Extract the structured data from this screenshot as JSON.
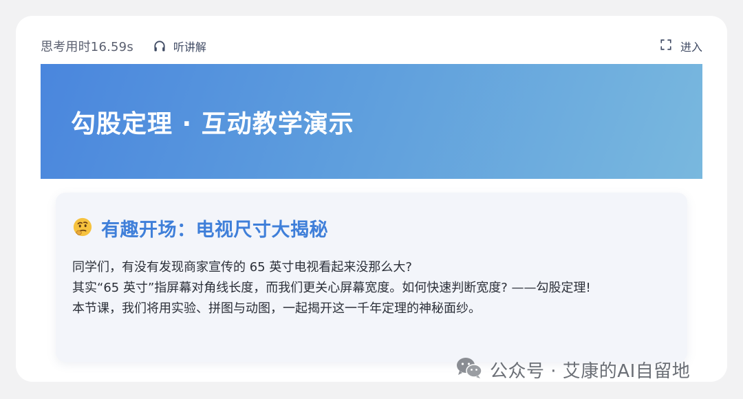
{
  "header": {
    "think_time": "思考用时16.59s",
    "listen_label": "听讲解",
    "enter_label": "进入"
  },
  "banner": {
    "title": "勾股定理 · 互动教学演示"
  },
  "section": {
    "emoji": "🤔",
    "title": "有趣开场：电视尺寸大揭秘",
    "paragraphs": [
      "同学们，有没有发现商家宣传的 65 英寸电视看起来没那么大?",
      "其实“65 英寸”指屏幕对角线长度，而我们更关心屏幕宽度。如何快速判断宽度? ——勾股定理!",
      "本节课，我们将用实验、拼图与动图，一起揭开这一千年定理的神秘面纱。"
    ]
  },
  "watermark": {
    "text": "公众号 · 艾康的AI自留地"
  },
  "colors": {
    "accent": "#3f7fd9",
    "banner_start": "#4a86dd",
    "banner_end": "#79b8de"
  },
  "icons": [
    "headphones-icon",
    "fullscreen-icon",
    "thinking-face-icon",
    "wechat-icon"
  ]
}
